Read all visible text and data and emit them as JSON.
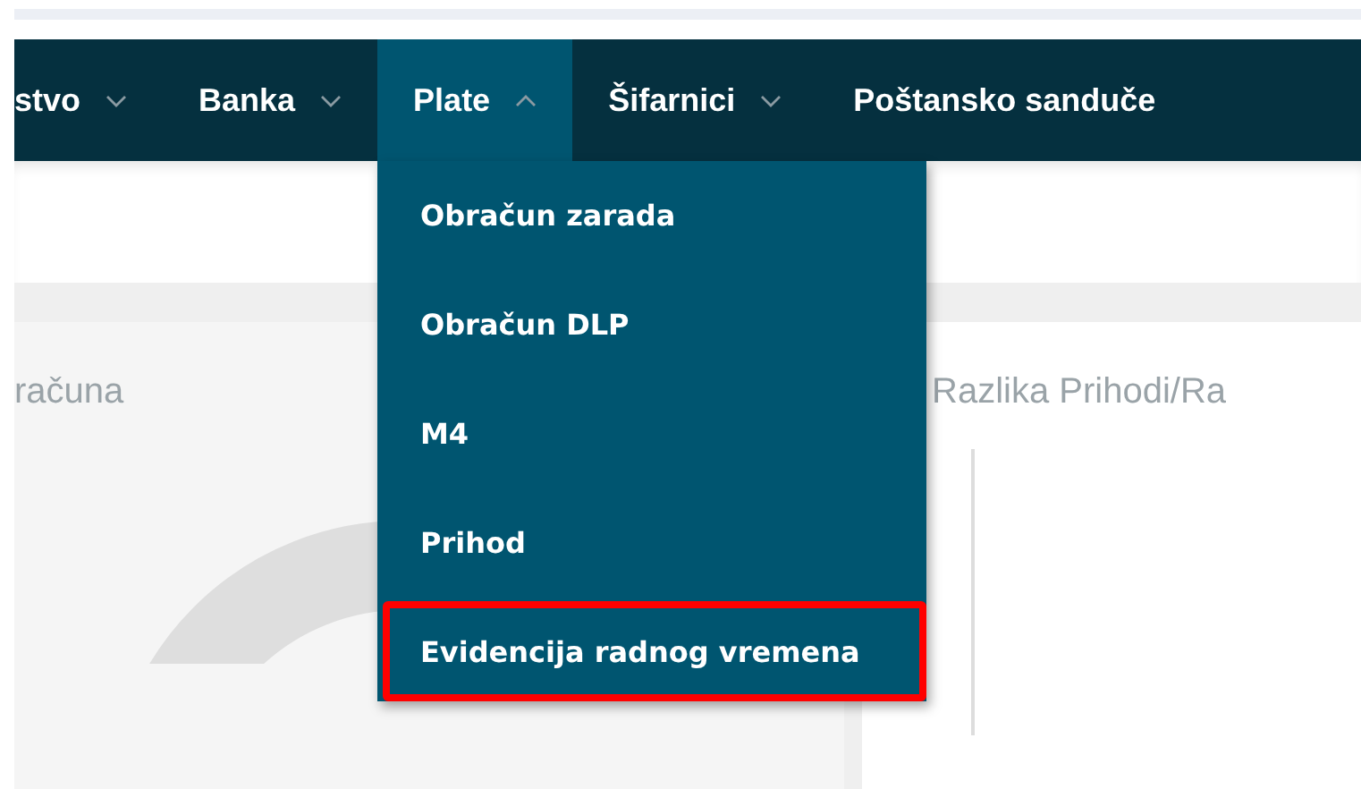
{
  "nav": [
    {
      "label": "stvo",
      "kind": "menu",
      "selected": false,
      "expanded": false
    },
    {
      "label": "Banka",
      "kind": "menu",
      "selected": false,
      "expanded": false
    },
    {
      "label": "Plate",
      "kind": "menu",
      "selected": true,
      "expanded": true
    },
    {
      "label": "Šifarnici",
      "kind": "menu",
      "selected": false,
      "expanded": false
    },
    {
      "label": "Poštansko sanduče",
      "kind": "link",
      "selected": false,
      "expanded": false
    }
  ],
  "dropdown": [
    {
      "label": "Obračun zarada",
      "highlighted": false
    },
    {
      "label": "Obračun DLP",
      "highlighted": false
    },
    {
      "label": "M4",
      "highlighted": false
    },
    {
      "label": "Prihod",
      "highlighted": false
    },
    {
      "label": "Evidencija radnog vremena",
      "highlighted": true
    }
  ],
  "panels": [
    {
      "title": "računa",
      "kind": "donut"
    },
    {
      "title": "Razlika Prihodi/Ra",
      "kind": "axis"
    }
  ]
}
